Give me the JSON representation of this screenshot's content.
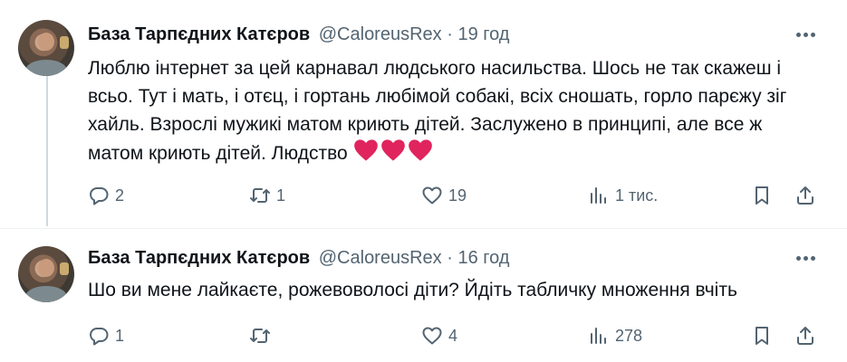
{
  "tweets": [
    {
      "author_name": "База Тарпєдних Катєров",
      "handle": "@CaloreusRex",
      "separator": "·",
      "time": "19 год",
      "text": "Люблю інтернет за цей карнавал людського насильства. Шось не так скажеш і всьо. Тут і мать, і отєц, і гортань любімой собакі, всіх сношать, горло парєжу зіг хайль. Взрослі мужикі матом криють дітей. Заслужено в принципі, але все ж матом криють дітей. Людство",
      "emoji": [
        "red-heart",
        "red-heart",
        "red-heart"
      ],
      "replies": "2",
      "retweets": "1",
      "likes": "19",
      "views": "1 тис."
    },
    {
      "author_name": "База Тарпєдних Катєров",
      "handle": "@CaloreusRex",
      "separator": "·",
      "time": "16 год",
      "text": "Шо ви мене лайкаєте, рожевоволосі діти? Йдіть табличку множення вчіть",
      "replies": "1",
      "retweets": "",
      "likes": "4",
      "views": "278"
    }
  ],
  "colors": {
    "text": "#0f1419",
    "secondary": "#536471",
    "heart": "#e0245e",
    "thread_line": "#cfd9de"
  }
}
